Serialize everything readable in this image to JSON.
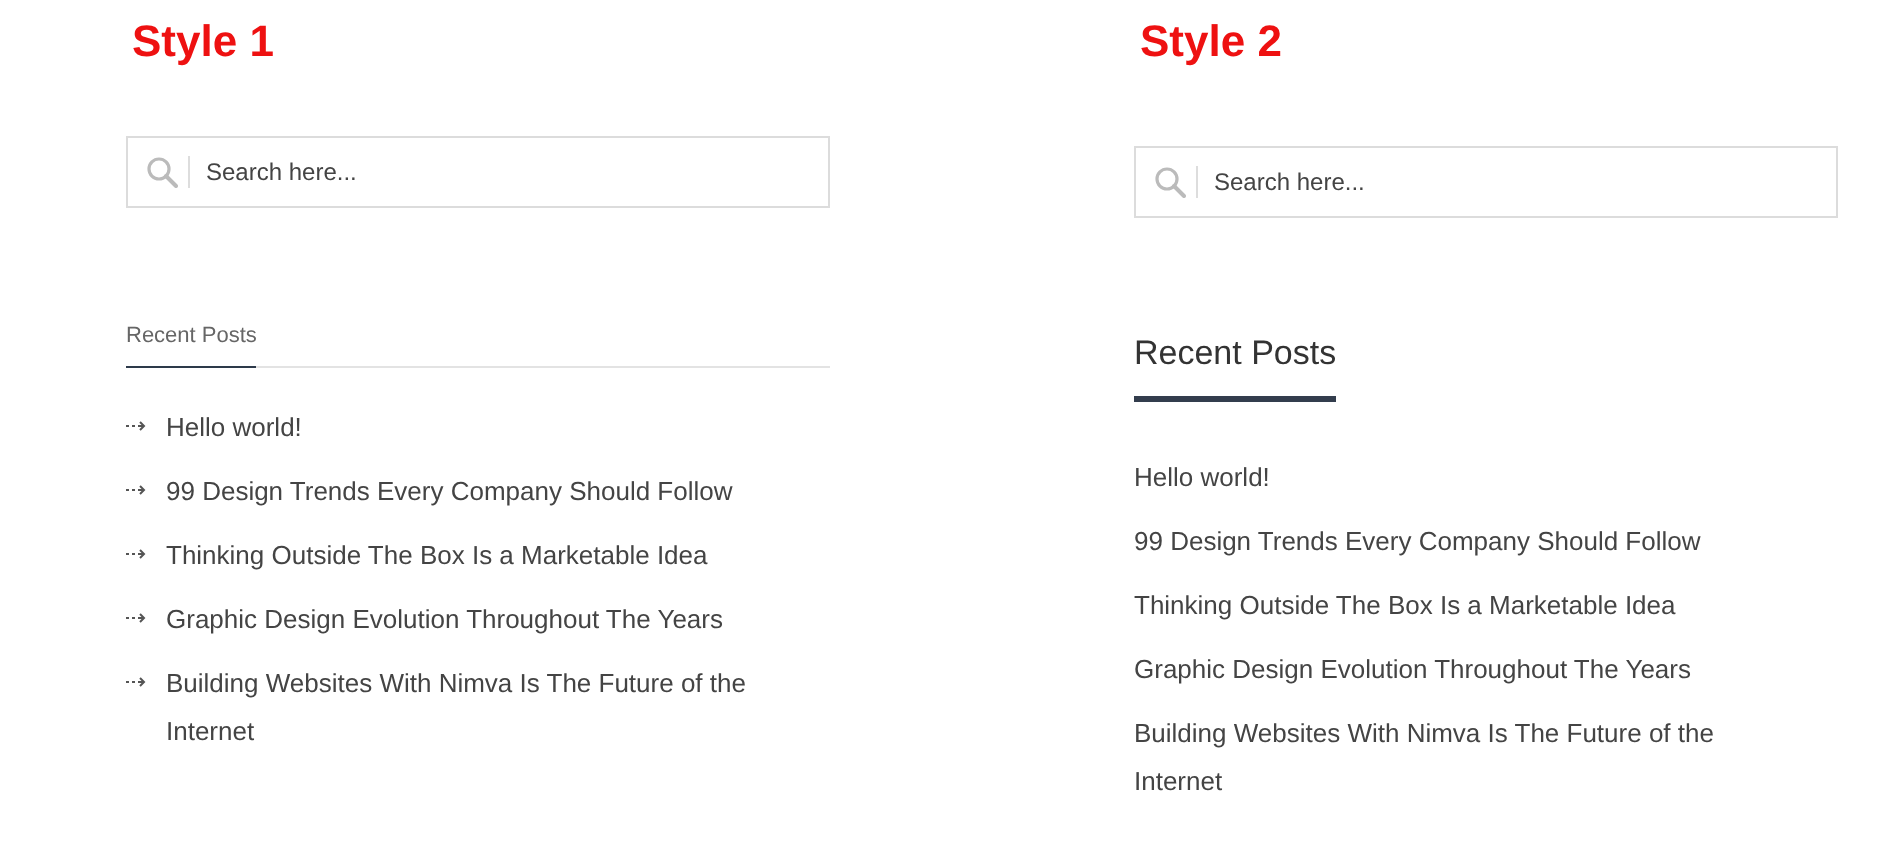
{
  "styles": [
    {
      "kind": "arrows",
      "title": "Style 1",
      "search": {
        "placeholder": "Search here..."
      },
      "heading": "Recent Posts",
      "posts": [
        "Hello world!",
        "99 Design Trends Every Company Should Follow",
        "Thinking Outside The Box Is a Marketable Idea",
        "Graphic Design Evolution Throughout The Years",
        "Building Websites With Nimva Is The Future of the Internet"
      ]
    },
    {
      "kind": "plain",
      "title": "Style 2",
      "search": {
        "placeholder": "Search here..."
      },
      "heading": "Recent Posts",
      "posts": [
        "Hello world!",
        "99 Design Trends Every Company Should Follow",
        "Thinking Outside The Box Is a Marketable Idea",
        "Graphic Design Evolution Throughout The Years",
        "Building Websites With Nimva Is The Future of the Internet"
      ]
    }
  ]
}
